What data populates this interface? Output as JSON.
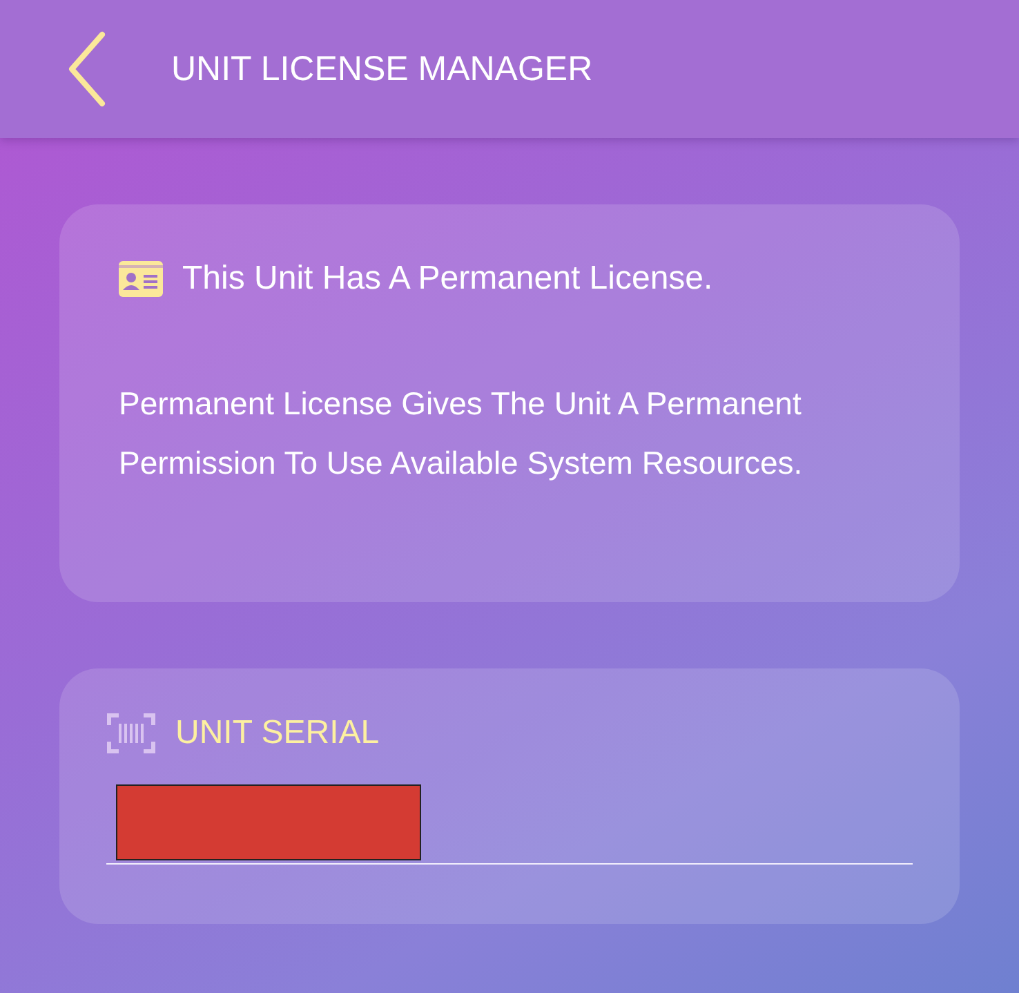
{
  "header": {
    "title": "UNIT LICENSE MANAGER"
  },
  "license_card": {
    "heading": "This Unit Has A Permanent License.",
    "description": "Permanent License Gives The Unit A Permanent Permission To Use Available System Resources."
  },
  "serial_card": {
    "label": "UNIT SERIAL",
    "value_redacted": true
  }
}
